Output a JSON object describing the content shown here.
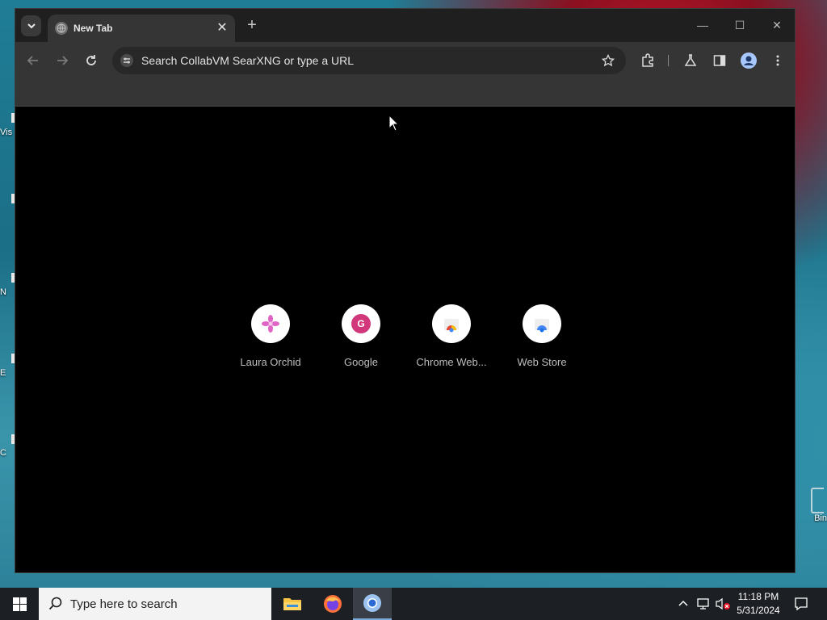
{
  "desktop": {
    "fragment_labels": [
      "Vis",
      "N",
      "E",
      "C"
    ],
    "recycle_label": "Bin"
  },
  "browser": {
    "tab": {
      "title": "New Tab"
    },
    "omnibox": {
      "placeholder": "Search CollabVM SearXNG or type a URL"
    },
    "shortcuts": [
      {
        "label": "Laura Orchid",
        "icon": "flower-icon",
        "color": "#e063c6"
      },
      {
        "label": "Google",
        "icon": "letter-g-icon",
        "letter": "G",
        "color": "#d1377a"
      },
      {
        "label": "Chrome Web...",
        "icon": "chrome-web-store-icon",
        "color": "#4285f4"
      },
      {
        "label": "Web Store",
        "icon": "web-store-icon",
        "color": "#4285f4"
      }
    ]
  },
  "taskbar": {
    "search_placeholder": "Type here to search",
    "clock": {
      "time": "11:18 PM",
      "date": "5/31/2024"
    }
  },
  "colors": {
    "window_bg": "#000000",
    "toolbar_bg": "#353535",
    "taskbar_bg": "#1c1f24"
  }
}
